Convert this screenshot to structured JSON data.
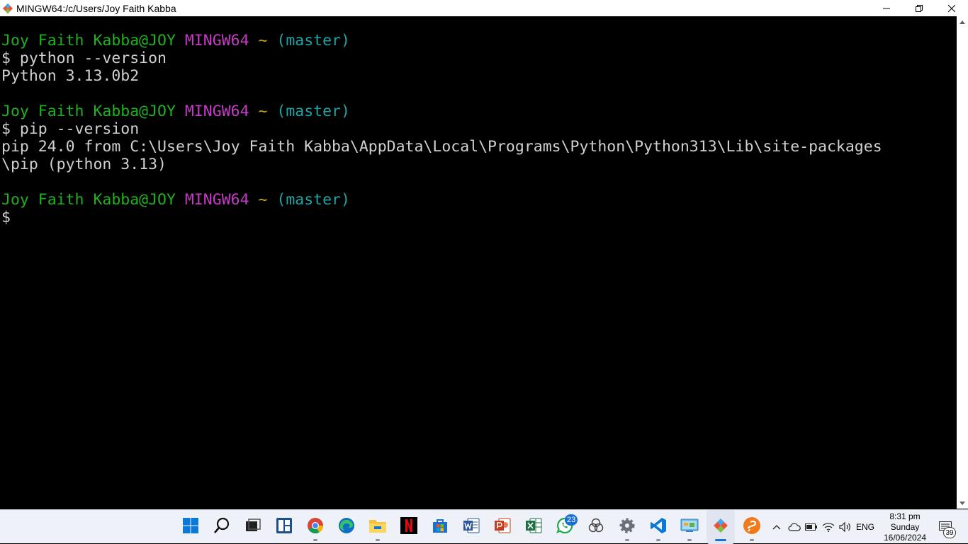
{
  "window": {
    "title": "MINGW64:/c/Users/Joy Faith Kabba",
    "minimize_icon": "minimize-icon",
    "restore_icon": "restore-icon",
    "close_icon": "close-icon"
  },
  "terminal": {
    "lines": [
      {
        "type": "prompt",
        "user": "Joy Faith Kabba@JOY",
        "system": "MINGW64",
        "path": "~",
        "branch": "(master)"
      },
      {
        "type": "cmd",
        "text": "$ python --version"
      },
      {
        "type": "out",
        "text": "Python 3.13.0b2"
      },
      {
        "type": "blank",
        "text": ""
      },
      {
        "type": "prompt",
        "user": "Joy Faith Kabba@JOY",
        "system": "MINGW64",
        "path": "~",
        "branch": "(master)"
      },
      {
        "type": "cmd",
        "text": "$ pip --version"
      },
      {
        "type": "out",
        "text": "pip 24.0 from C:\\Users\\Joy Faith Kabba\\AppData\\Local\\Programs\\Python\\Python313\\Lib\\site-packages"
      },
      {
        "type": "out",
        "text": "\\pip (python 3.13)"
      },
      {
        "type": "blank",
        "text": ""
      },
      {
        "type": "prompt",
        "user": "Joy Faith Kabba@JOY",
        "system": "MINGW64",
        "path": "~",
        "branch": "(master)"
      },
      {
        "type": "cmd",
        "text": "$"
      }
    ]
  },
  "taskbar": {
    "apps": [
      {
        "name": "windows-start-icon",
        "running": false,
        "active": false
      },
      {
        "name": "search-icon",
        "running": false,
        "active": false
      },
      {
        "name": "task-view-icon",
        "running": false,
        "active": false
      },
      {
        "name": "widgets-icon",
        "running": false,
        "active": false
      },
      {
        "name": "chrome-icon",
        "running": true,
        "active": false
      },
      {
        "name": "edge-icon",
        "running": false,
        "active": false
      },
      {
        "name": "file-explorer-icon",
        "running": true,
        "active": false
      },
      {
        "name": "netflix-icon",
        "running": false,
        "active": false
      },
      {
        "name": "microsoft-store-icon",
        "running": false,
        "active": false
      },
      {
        "name": "word-icon",
        "running": false,
        "active": false
      },
      {
        "name": "powerpoint-icon",
        "running": false,
        "active": false
      },
      {
        "name": "excel-icon",
        "running": false,
        "active": false
      },
      {
        "name": "whatsapp-icon",
        "running": false,
        "active": false,
        "badge": "23"
      },
      {
        "name": "copilot-icon",
        "running": false,
        "active": false
      },
      {
        "name": "settings-icon",
        "running": true,
        "active": false
      },
      {
        "name": "vscode-icon",
        "running": true,
        "active": false
      },
      {
        "name": "control-panel-icon",
        "running": true,
        "active": false
      },
      {
        "name": "git-bash-icon",
        "running": true,
        "active": true
      },
      {
        "name": "sublime-icon",
        "running": true,
        "active": false
      }
    ],
    "tray": {
      "language": "ENG",
      "time": "8:31 pm",
      "day": "Sunday",
      "date": "16/06/2024",
      "notifications": "39"
    }
  },
  "colors": {
    "user": "#1fb21f",
    "system": "#c43cc4",
    "tilde": "#c8a800",
    "branch": "#1ca5a5",
    "output": "#d0d0d0",
    "accent": "#1670d8"
  }
}
